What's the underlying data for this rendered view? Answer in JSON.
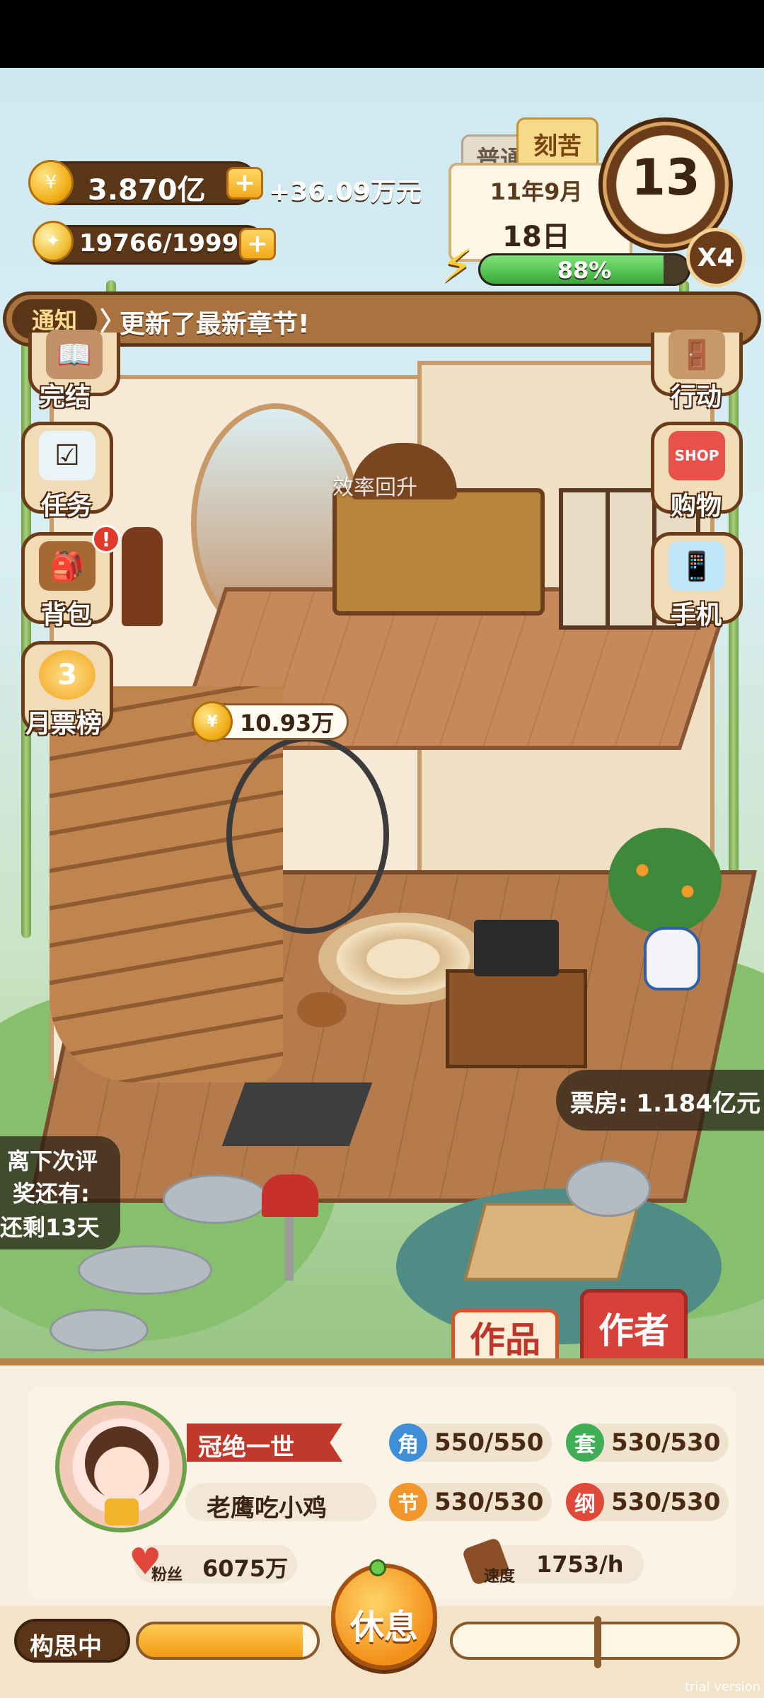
{
  "hud": {
    "money": "3.870亿",
    "money_rate": "+36.09万元",
    "inspiration": "19766/19999",
    "plus_symbol": "+",
    "mode_normal": "普通",
    "mode_hard": "刻苦",
    "date_year_month": "11年9月",
    "date_day": "18日",
    "energy_percent": "88%",
    "energy_fraction": 0.88,
    "dial_number": "13",
    "speed_multiplier": "X4"
  },
  "notice": {
    "tag": "通知",
    "arrow": "〉",
    "message": "更新了最新章节!"
  },
  "left_menu": [
    {
      "label": "完结",
      "icon": "book-icon"
    },
    {
      "label": "任务",
      "icon": "checklist-icon"
    },
    {
      "label": "背包",
      "icon": "backpack-icon",
      "badge": "!"
    },
    {
      "label": "月票榜",
      "icon": "ticket-icon",
      "number": "3"
    }
  ],
  "right_menu": [
    {
      "label": "行动",
      "icon": "door-icon"
    },
    {
      "label": "购物",
      "icon": "shop-icon",
      "sign": "SHOP"
    },
    {
      "label": "手机",
      "icon": "phone-icon"
    }
  ],
  "scene": {
    "floating_text": "效率回升",
    "income_bubble": "10.93万",
    "box_office": "票房: 1.184亿元",
    "review_countdown_line1": "离下次评",
    "review_countdown_line2": "奖还有:",
    "review_countdown_line3": "还剩13天"
  },
  "tabs": {
    "works": "作品",
    "author": "作者"
  },
  "profile": {
    "title": "冠绝一世",
    "name": "老鹰吃小鸡",
    "fans_label": "粉丝",
    "fans": "6075万",
    "speed_label": "速度",
    "speed": "1753/h"
  },
  "stats": [
    {
      "icon_char": "角",
      "value": "550/550",
      "color": "#3f8fd8"
    },
    {
      "icon_char": "套",
      "value": "530/530",
      "color": "#3fae57"
    },
    {
      "icon_char": "节",
      "value": "530/530",
      "color": "#f0962a"
    },
    {
      "icon_char": "纲",
      "value": "530/530",
      "color": "#e0483a"
    }
  ],
  "bottom_bar": {
    "status": "构思中",
    "progress_fraction": 0.92,
    "rest_button": "休息",
    "watermark": "trial version"
  }
}
